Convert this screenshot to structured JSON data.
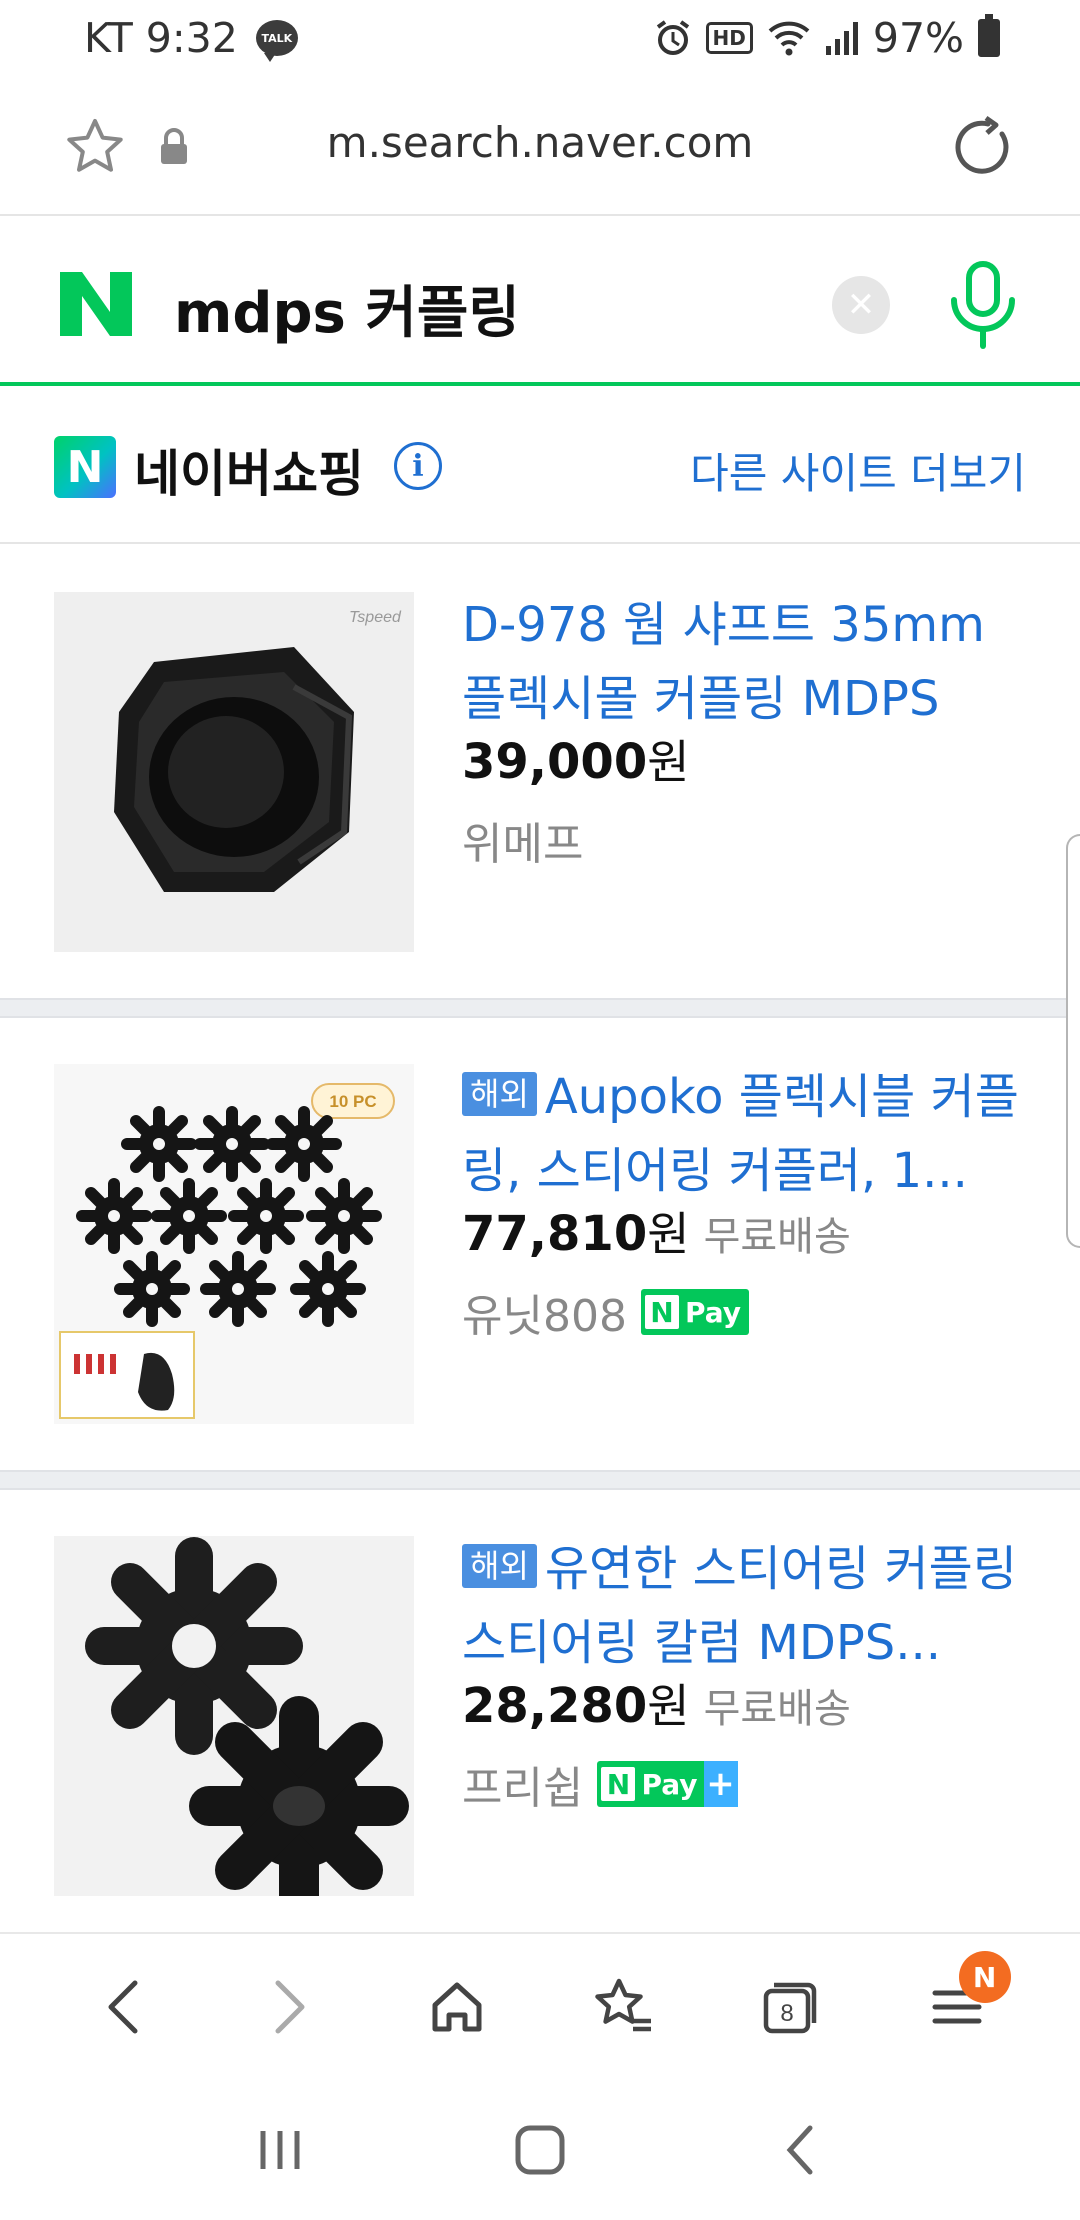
{
  "status_bar": {
    "carrier_time": "KT 9:32",
    "talk_label": "TALK",
    "hd_label": "HD",
    "battery": "97%"
  },
  "browser": {
    "url": "m.search.naver.com",
    "tab_count": "8",
    "menu_badge": "N"
  },
  "search": {
    "query": "mdps 커플링",
    "clear_symbol": "✕"
  },
  "shopping": {
    "logo_letter": "N",
    "title": "네이버쇼핑",
    "info_symbol": "i",
    "more_link": "다른 사이트 더보기"
  },
  "products": [
    {
      "badge": "",
      "title": "D-978 웜 샤프트 35mm 플렉시몰 커플링 MDPS",
      "price": "39,000",
      "currency": "원",
      "shipping": "",
      "seller": "위메프",
      "npay": false,
      "npay_plus": false
    },
    {
      "badge": "해외",
      "title": "Aupoko 플렉시블 커플링, 스티어링 커플러, 1...",
      "price": "77,810",
      "currency": "원",
      "shipping": "무료배송",
      "seller": "유닛808",
      "npay": true,
      "npay_plus": false
    },
    {
      "badge": "해외",
      "title": "유연한 스티어링 커플링 스티어링 칼럼 MDPS...",
      "price": "28,280",
      "currency": "원",
      "shipping": "무료배송",
      "seller": "프리쉽",
      "npay": true,
      "npay_plus": true
    }
  ],
  "npay_label": {
    "n": "N",
    "pay": "Pay",
    "plus": "+"
  },
  "thumb_text": {
    "brand": "Tspeed",
    "pack": "10 PC"
  },
  "colors": {
    "naver_green": "#03c75a",
    "link_blue": "#1f6fd1",
    "badge_orange": "#f36c21"
  }
}
